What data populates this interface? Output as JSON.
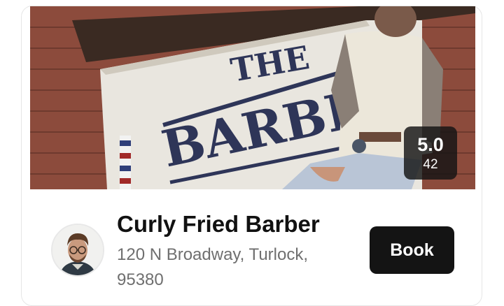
{
  "shop": {
    "name": "Curly Fried Barber",
    "address": "120 N Broadway, Turlock, 95380",
    "rating": "5.0",
    "review_count": "42",
    "photo_sign_text": [
      "THE",
      "BARBE"
    ]
  },
  "actions": {
    "book_label": "Book"
  },
  "colors": {
    "button_bg": "#141414",
    "rating_badge_bg": "#141414",
    "address_text": "#6f6f6f"
  }
}
